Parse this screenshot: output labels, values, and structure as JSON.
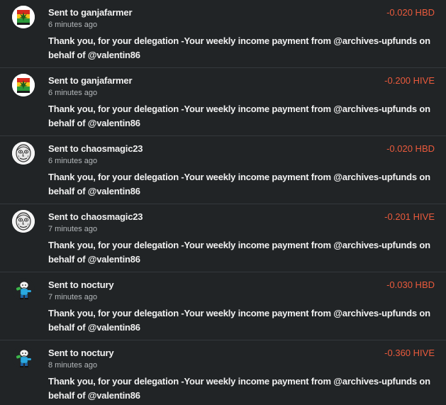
{
  "transfers": [
    {
      "prefix": "Sent to ",
      "user": "ganjafarmer",
      "time": "6 minutes ago",
      "amount": "-0.020 HBD",
      "memo": "Thank you, for your delegation -Your weekly income payment from @archives-upfunds on behalf of @valentin86",
      "avatar": "ganja-logo"
    },
    {
      "prefix": "Sent to ",
      "user": "ganjafarmer",
      "time": "6 minutes ago",
      "amount": "-0.200 HIVE",
      "memo": "Thank you, for your delegation -Your weekly income payment from @archives-upfunds on behalf of @valentin86",
      "avatar": "ganja-logo"
    },
    {
      "prefix": "Sent to ",
      "user": "chaosmagic23",
      "time": "6 minutes ago",
      "amount": "-0.020 HBD",
      "memo": "Thank you, for your delegation -Your weekly income payment from @archives-upfunds on behalf of @valentin86",
      "avatar": "face-sketch"
    },
    {
      "prefix": "Sent to ",
      "user": "chaosmagic23",
      "time": "7 minutes ago",
      "amount": "-0.201 HIVE",
      "memo": "Thank you, for your delegation -Your weekly income payment from @archives-upfunds on behalf of @valentin86",
      "avatar": "face-sketch"
    },
    {
      "prefix": "Sent to ",
      "user": "noctury",
      "time": "7 minutes ago",
      "amount": "-0.030 HBD",
      "memo": "Thank you, for your delegation -Your weekly income payment from @archives-upfunds on behalf of @valentin86",
      "avatar": "cartoon-character"
    },
    {
      "prefix": "Sent to ",
      "user": "noctury",
      "time": "8 minutes ago",
      "amount": "-0.360 HIVE",
      "memo": "Thank you, for your delegation -Your weekly income payment from @archives-upfunds on behalf of @valentin86",
      "avatar": "cartoon-character"
    }
  ],
  "colors": {
    "background": "#212426",
    "amount": "#ea5a3c",
    "text": "#f1f1f1",
    "muted": "#b4b8bb"
  }
}
